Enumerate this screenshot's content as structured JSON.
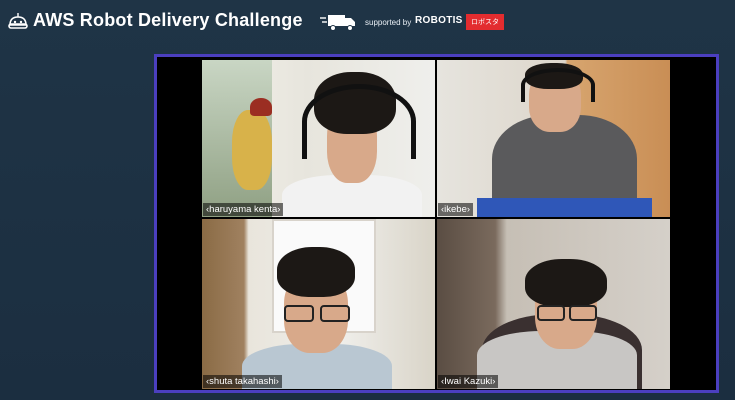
{
  "banner": {
    "title": "AWS Robot Delivery Challenge",
    "supported_label": "supported by",
    "sponsor_1": "ROBOTIS",
    "sponsor_2": "ロボスタ"
  },
  "participants": [
    {
      "name": "‹haruyama kenta›"
    },
    {
      "name": "‹ikebe›"
    },
    {
      "name": "‹shuta takahashi›"
    },
    {
      "name": "‹Iwai Kazuki›"
    }
  ],
  "colors": {
    "background": "#1d3144",
    "frame_border": "#4b3fbf",
    "sponsor_red": "#e32c2f"
  },
  "icons": [
    "robot-head-icon",
    "delivery-truck-icon"
  ]
}
